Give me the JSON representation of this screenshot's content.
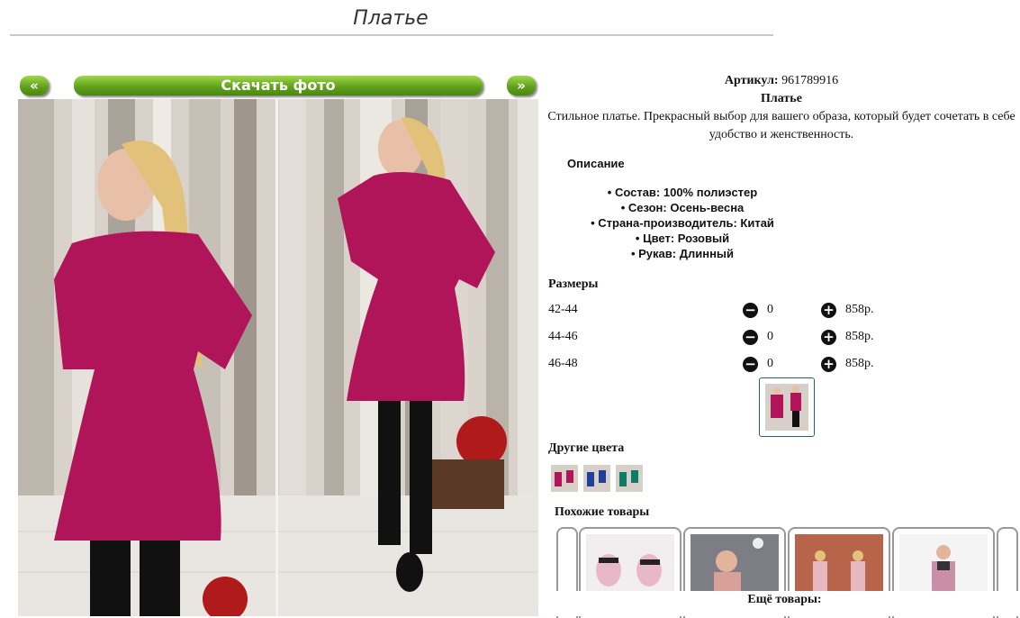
{
  "page": {
    "title": "Платье"
  },
  "nav": {
    "prev": "«",
    "download": "Скачать фото",
    "next": "»"
  },
  "product": {
    "article_label": "Артикул:",
    "article": "961789916",
    "name": "Платье",
    "tagline": "Стильное платье. Прекрасный выбор для вашего образа, который будет сочетать в себе удобство и женственность."
  },
  "description": {
    "title": "Описание",
    "specs": [
      "Состав: 100% полиэстер",
      "Сезон: Осень-весна",
      "Страна-производитель: Китай",
      "Цвет: Розовый",
      "Рукав: Длинный"
    ]
  },
  "sizes": {
    "title": "Размеры",
    "rows": [
      {
        "size": "42-44",
        "qty": "0",
        "price": "858р."
      },
      {
        "size": "44-46",
        "qty": "0",
        "price": "858р."
      },
      {
        "size": "46-48",
        "qty": "0",
        "price": "858р."
      }
    ]
  },
  "other_colors": {
    "title": "Другие цвета"
  },
  "similar": {
    "title": "Похожие товары"
  },
  "more": {
    "title": "Ещё товары:"
  },
  "colors": {
    "accent_green": "#5e9e1a",
    "dress": "#b0155a"
  }
}
